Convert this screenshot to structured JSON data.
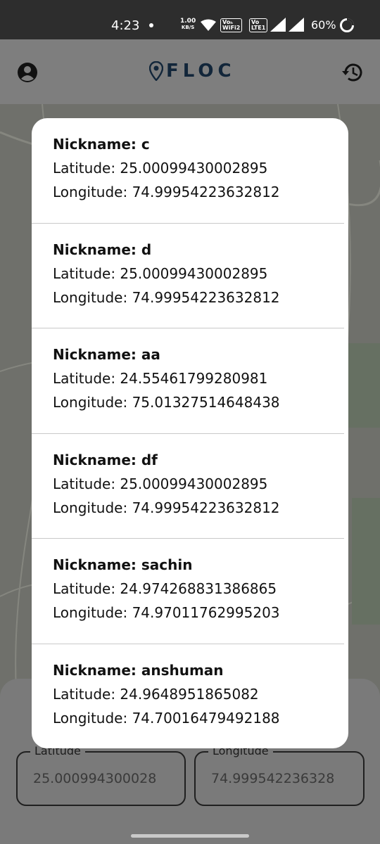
{
  "status_bar": {
    "time": "4:23",
    "speed_value": "1.00",
    "speed_unit": "KB/S",
    "volte1_top": "Voₕ",
    "volte1_bottom": "WiFi2",
    "volte2_top": "Vo",
    "volte2_bottom": "LTE1",
    "battery": "60%"
  },
  "app_bar": {
    "title": "FLOC",
    "left_icon": "account-circle-icon",
    "right_icon": "history-icon"
  },
  "dialog": {
    "items": [
      {
        "nickname": "Nickname: c",
        "latitude": "Latitude: 25.00099430002895",
        "longitude": "Longitude: 74.99954223632812"
      },
      {
        "nickname": "Nickname: d",
        "latitude": "Latitude: 25.00099430002895",
        "longitude": "Longitude: 74.99954223632812"
      },
      {
        "nickname": "Nickname: aa",
        "latitude": "Latitude: 24.55461799280981",
        "longitude": "Longitude: 75.01327514648438"
      },
      {
        "nickname": "Nickname: df",
        "latitude": "Latitude: 25.00099430002895",
        "longitude": "Longitude: 74.99954223632812"
      },
      {
        "nickname": "Nickname: sachin",
        "latitude": "Latitude: 24.974268831386865",
        "longitude": "Longitude: 74.97011762995203"
      },
      {
        "nickname": "Nickname: anshuman",
        "latitude": "Latitude: 24.9648951865082",
        "longitude": "Longitude: 74.70016479492188"
      }
    ]
  },
  "form": {
    "latitude_label": "Latitude",
    "latitude_value": "25.000994300028",
    "longitude_label": "Longitude",
    "longitude_value": "74.999542236328"
  },
  "colors": {
    "brand": "#12263a",
    "scrim": "#7a7a7a",
    "dialog_bg": "#ffffff",
    "status_bar": "#2d2d2d"
  }
}
